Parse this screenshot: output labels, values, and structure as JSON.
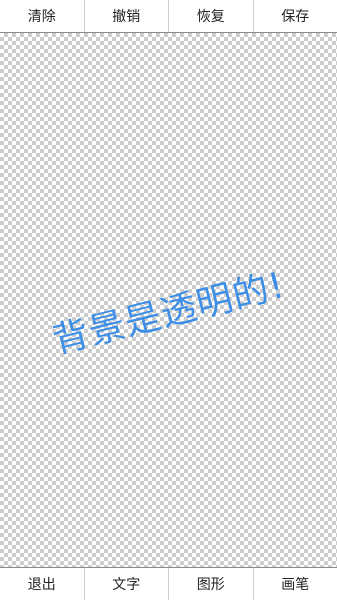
{
  "top_toolbar": {
    "buttons": [
      {
        "label": "清除"
      },
      {
        "label": "撤销"
      },
      {
        "label": "恢复"
      },
      {
        "label": "保存"
      }
    ]
  },
  "canvas": {
    "text": "背景是透明的!",
    "text_color": "#3c8ee6"
  },
  "bottom_toolbar": {
    "buttons": [
      {
        "label": "退出"
      },
      {
        "label": "文字"
      },
      {
        "label": "图形"
      },
      {
        "label": "画笔"
      }
    ]
  }
}
